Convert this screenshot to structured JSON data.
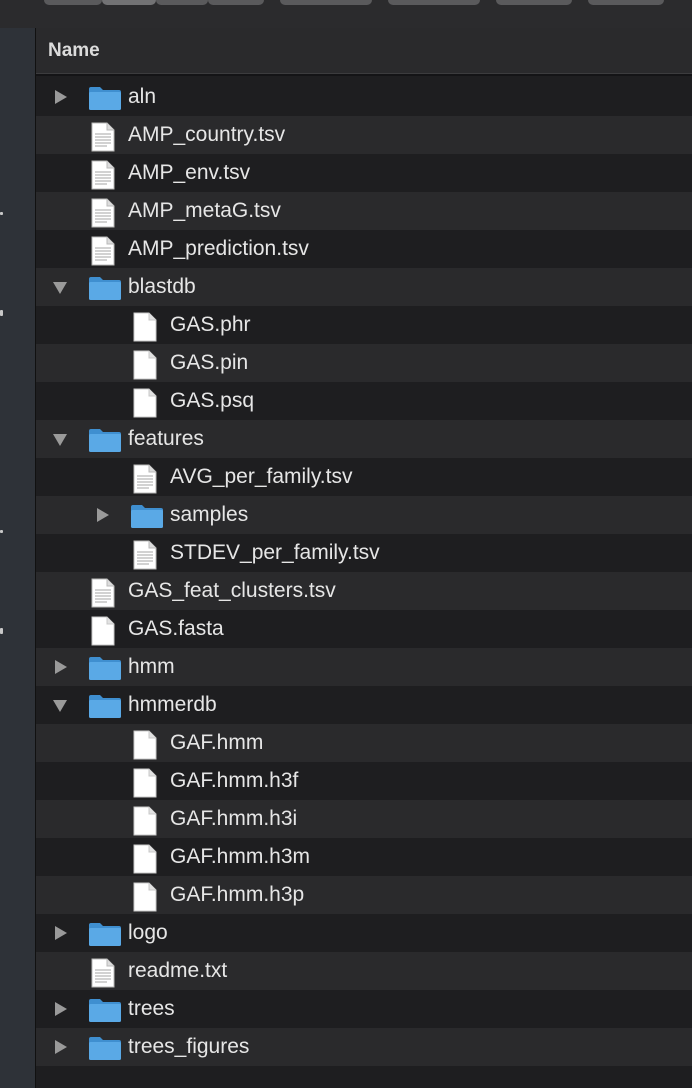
{
  "colors": {
    "folder": "#5aa9e6",
    "folder_dark": "#3f8fd0",
    "file_page": "#ffffff",
    "text": "#e6e6e6",
    "alt_row": "#2a2a2c"
  },
  "header": {
    "name_column": "Name"
  },
  "rows": [
    {
      "label": "aln",
      "kind": "folder",
      "depth": 0,
      "expanded": false
    },
    {
      "label": "AMP_country.tsv",
      "kind": "doc",
      "depth": 0
    },
    {
      "label": "AMP_env.tsv",
      "kind": "doc",
      "depth": 0
    },
    {
      "label": "AMP_metaG.tsv",
      "kind": "doc",
      "depth": 0
    },
    {
      "label": "AMP_prediction.tsv",
      "kind": "doc",
      "depth": 0
    },
    {
      "label": "blastdb",
      "kind": "folder",
      "depth": 0,
      "expanded": true
    },
    {
      "label": "GAS.phr",
      "kind": "blank",
      "depth": 1
    },
    {
      "label": "GAS.pin",
      "kind": "blank",
      "depth": 1
    },
    {
      "label": "GAS.psq",
      "kind": "blank",
      "depth": 1
    },
    {
      "label": "features",
      "kind": "folder",
      "depth": 0,
      "expanded": true
    },
    {
      "label": "AVG_per_family.tsv",
      "kind": "doc",
      "depth": 1
    },
    {
      "label": "samples",
      "kind": "folder",
      "depth": 1,
      "expanded": false
    },
    {
      "label": "STDEV_per_family.tsv",
      "kind": "doc",
      "depth": 1
    },
    {
      "label": "GAS_feat_clusters.tsv",
      "kind": "doc",
      "depth": 0
    },
    {
      "label": "GAS.fasta",
      "kind": "blank",
      "depth": 0
    },
    {
      "label": "hmm",
      "kind": "folder",
      "depth": 0,
      "expanded": false
    },
    {
      "label": "hmmerdb",
      "kind": "folder",
      "depth": 0,
      "expanded": true
    },
    {
      "label": "GAF.hmm",
      "kind": "blank",
      "depth": 1
    },
    {
      "label": "GAF.hmm.h3f",
      "kind": "blank",
      "depth": 1
    },
    {
      "label": "GAF.hmm.h3i",
      "kind": "blank",
      "depth": 1
    },
    {
      "label": "GAF.hmm.h3m",
      "kind": "blank",
      "depth": 1
    },
    {
      "label": "GAF.hmm.h3p",
      "kind": "blank",
      "depth": 1
    },
    {
      "label": "logo",
      "kind": "folder",
      "depth": 0,
      "expanded": false
    },
    {
      "label": "readme.txt",
      "kind": "doc",
      "depth": 0
    },
    {
      "label": "trees",
      "kind": "folder",
      "depth": 0,
      "expanded": false
    },
    {
      "label": "trees_figures",
      "kind": "folder",
      "depth": 0,
      "expanded": false
    }
  ]
}
